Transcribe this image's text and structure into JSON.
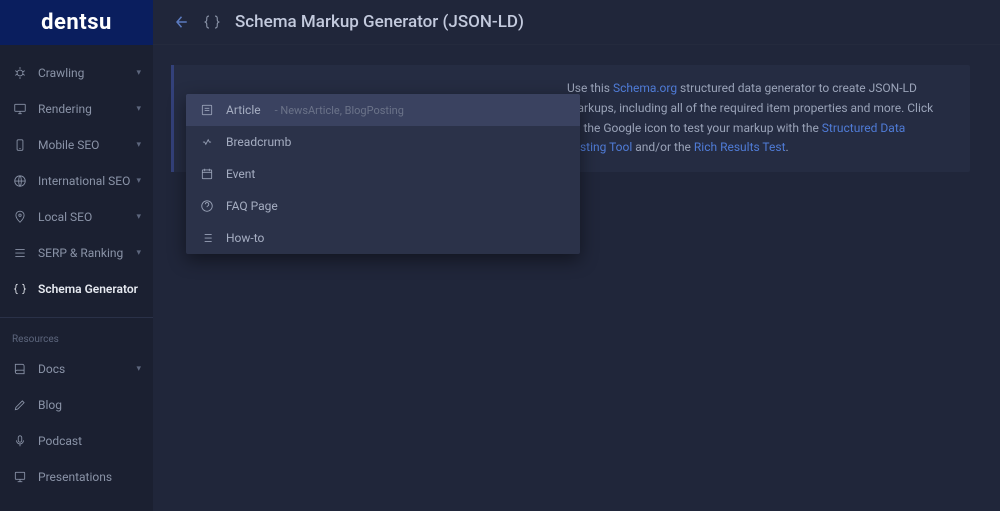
{
  "brand": "dentsu",
  "header": {
    "title": "Schema Markup Generator (JSON-LD)"
  },
  "sidebar": {
    "items": [
      {
        "label": "Crawling",
        "expandable": true
      },
      {
        "label": "Rendering",
        "expandable": true
      },
      {
        "label": "Mobile SEO",
        "expandable": true
      },
      {
        "label": "International SEO",
        "expandable": true
      },
      {
        "label": "Local SEO",
        "expandable": true
      },
      {
        "label": "SERP & Ranking",
        "expandable": true
      },
      {
        "label": "Schema Generator",
        "expandable": false,
        "active": true
      }
    ],
    "resources_label": "Resources",
    "resources": [
      {
        "label": "Docs",
        "expandable": true
      },
      {
        "label": "Blog",
        "expandable": false
      },
      {
        "label": "Podcast",
        "expandable": false
      },
      {
        "label": "Presentations",
        "expandable": false
      }
    ]
  },
  "intro": {
    "pre": "Use this ",
    "link1": "Schema.org",
    "mid1": " structured data generator to create JSON-LD markups, including all of the required item properties and more. Click on the Google icon to test your markup with the ",
    "link2": "Structured Data Testing Tool",
    "mid2": " and/or the ",
    "link3": "Rich Results Test",
    "post": "."
  },
  "dropdown": {
    "items": [
      {
        "label": "Article",
        "sub": "NewsArticle, BlogPosting",
        "highlighted": true
      },
      {
        "label": "Breadcrumb"
      },
      {
        "label": "Event"
      },
      {
        "label": "FAQ Page"
      },
      {
        "label": "How-to"
      }
    ]
  }
}
